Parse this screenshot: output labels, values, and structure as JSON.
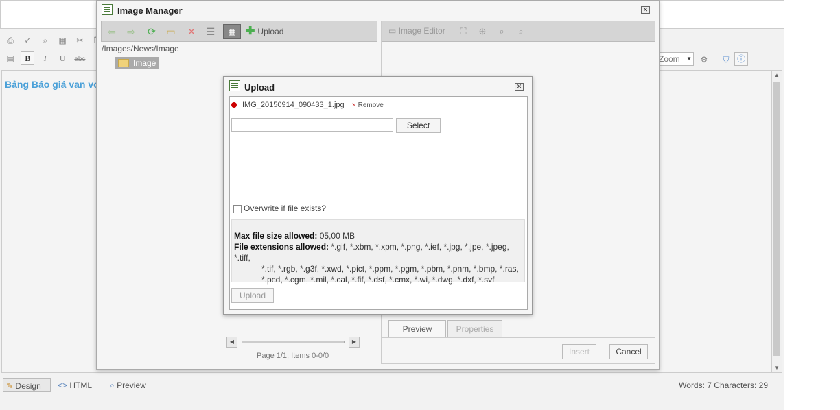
{
  "editor": {
    "content_text": "Bảng Báo giá van vo",
    "zoom_label": "Zoom",
    "modes": {
      "design": "Design",
      "html": "HTML",
      "preview": "Preview"
    },
    "stats": "Words: 7   Characters: 29"
  },
  "image_manager": {
    "title": "Image Manager",
    "upload_label": "Upload",
    "path": "/Images/News/Image",
    "tree_root": "Image",
    "pager": "Page 1/1; Items 0-0/0",
    "image_editor_label": "Image Editor",
    "tabs": {
      "preview": "Preview",
      "properties": "Properties"
    },
    "insert_label": "Insert",
    "cancel_label": "Cancel"
  },
  "upload_dialog": {
    "title": "Upload",
    "file_name": "IMG_20150914_090433_1.jpg",
    "remove_mark": "×",
    "remove_label": "Remove",
    "select_label": "Select",
    "overwrite_label": "Overwrite if file exists?",
    "max_size_label": "Max file size allowed:",
    "max_size_value": "05,00 MB",
    "ext_label": "File extensions allowed:",
    "ext_first": "*.gif, *.xbm, *.xpm, *.png, *.ief, *.jpg, *.jpe, *.jpeg, *.tiff,",
    "ext_rest": "*.tif, *.rgb, *.g3f, *.xwd, *.pict, *.ppm, *.pgm, *.pbm, *.pnm, *.bmp, *.ras, *.pcd, *.cgm, *.mil, *.cal, *.fif, *.dsf, *.cmx, *.wi, *.dwg, *.dxf, *.svf",
    "upload_button": "Upload"
  },
  "colors": {
    "accent_blue": "#4aa0d8",
    "remove_red": "#cc0000"
  }
}
